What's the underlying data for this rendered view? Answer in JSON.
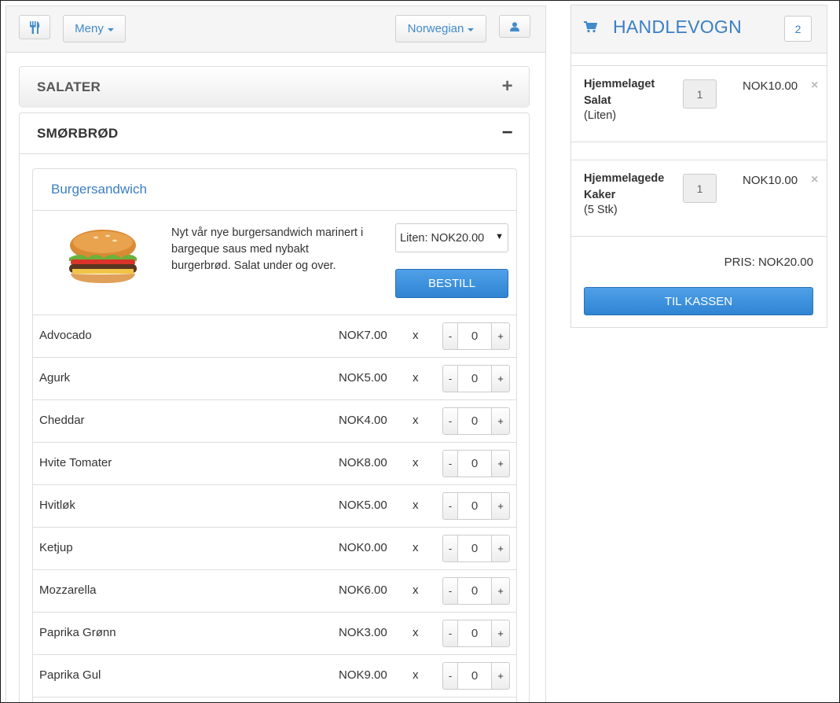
{
  "topbar": {
    "menu_label": "Meny",
    "language_label": "Norwegian",
    "icons": [
      "restaurant-icon",
      "user-icon"
    ]
  },
  "categories": [
    {
      "label": "SALATER",
      "expanded": false,
      "sign": "+"
    },
    {
      "label": "SMØRBRØD",
      "expanded": true,
      "sign": "−"
    }
  ],
  "product": {
    "title": "Burgersandwich",
    "description": "Nyt vår nye burgersandwich marinert i bargeque saus med nybakt burgerbrød. Salat under og over.",
    "selected_size": "Liten: NOK20.00",
    "order_label": "BESTILL"
  },
  "extras": [
    {
      "name": "Advocado",
      "price": "NOK7.00",
      "times": "x",
      "qty": "0"
    },
    {
      "name": "Agurk",
      "price": "NOK5.00",
      "times": "x",
      "qty": "0"
    },
    {
      "name": "Cheddar",
      "price": "NOK4.00",
      "times": "x",
      "qty": "0"
    },
    {
      "name": "Hvite Tomater",
      "price": "NOK8.00",
      "times": "x",
      "qty": "0"
    },
    {
      "name": "Hvitløk",
      "price": "NOK5.00",
      "times": "x",
      "qty": "0"
    },
    {
      "name": "Ketjup",
      "price": "NOK0.00",
      "times": "x",
      "qty": "0"
    },
    {
      "name": "Mozzarella",
      "price": "NOK6.00",
      "times": "x",
      "qty": "0"
    },
    {
      "name": "Paprika Grønn",
      "price": "NOK3.00",
      "times": "x",
      "qty": "0"
    },
    {
      "name": "Paprika Gul",
      "price": "NOK9.00",
      "times": "x",
      "qty": "0"
    }
  ],
  "stepper": {
    "minus": "-",
    "plus": "+"
  },
  "cart": {
    "title": "HANDLEVOGN",
    "count": "2",
    "items": [
      {
        "name": "Hjemmelaget Salat",
        "variant": "(Liten)",
        "qty": "1",
        "price": "NOK10.00",
        "remove": "×"
      },
      {
        "name": "Hjemmelagede Kaker",
        "variant": "(5 Stk)",
        "qty": "1",
        "price": "NOK10.00",
        "remove": "×"
      }
    ],
    "total": "PRIS: NOK20.00",
    "checkout_label": "TIL KASSEN"
  },
  "colors": {
    "accent": "#428bca",
    "primary_button": "#2f84d2"
  }
}
